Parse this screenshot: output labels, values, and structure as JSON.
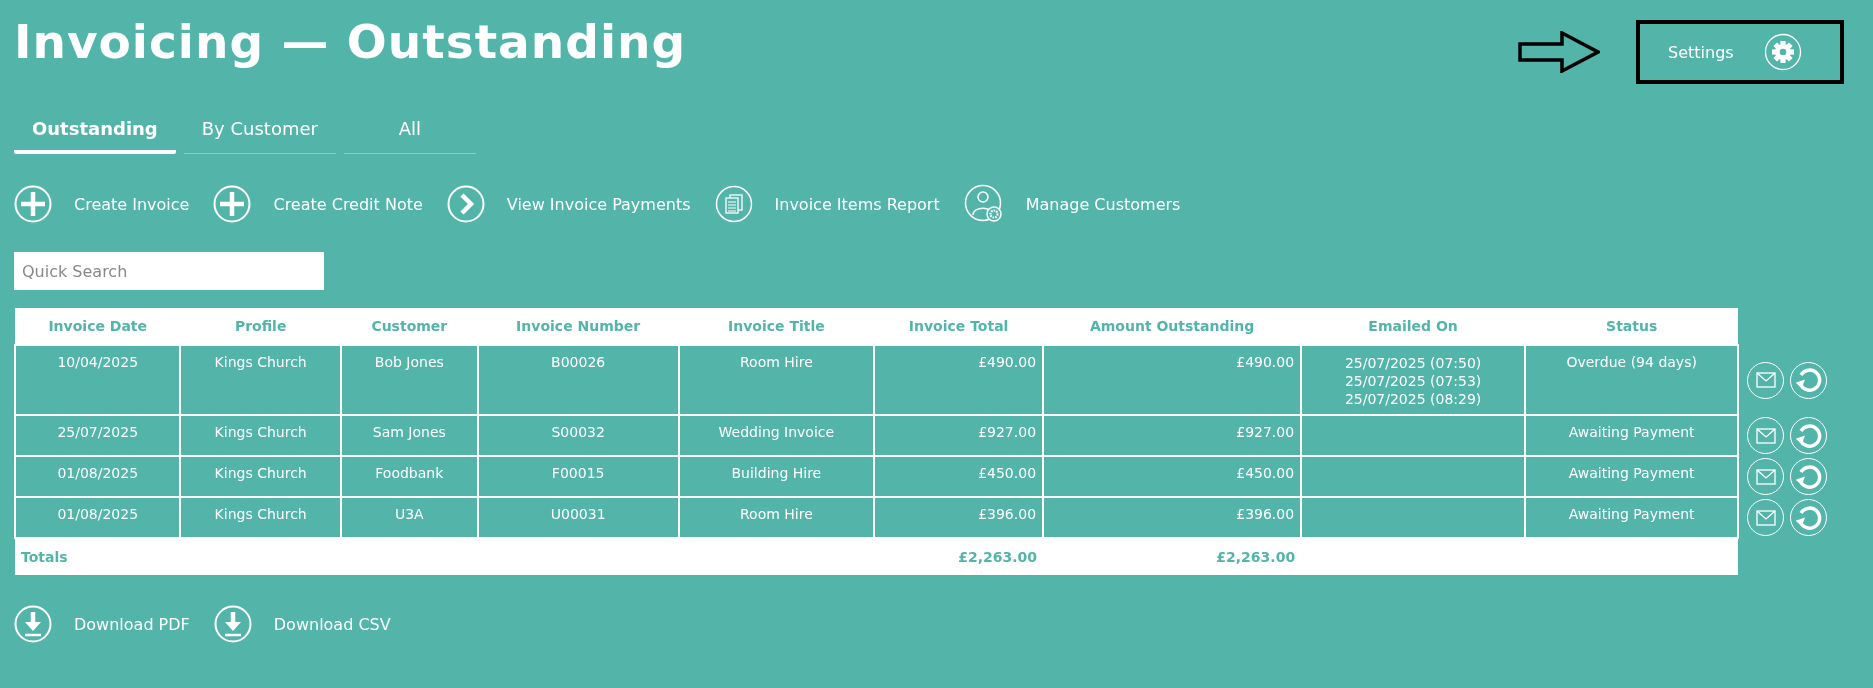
{
  "title": "Invoicing — Outstanding",
  "settings": {
    "label": "Settings"
  },
  "tabs": [
    {
      "label": "Outstanding",
      "selected": true
    },
    {
      "label": "By Customer",
      "selected": false
    },
    {
      "label": "All",
      "selected": false
    }
  ],
  "actions": [
    {
      "label": "Create Invoice",
      "kind": "plus"
    },
    {
      "label": "Create Credit Note",
      "kind": "plus"
    },
    {
      "label": "View Invoice Payments",
      "kind": "chevron"
    },
    {
      "label": "Invoice Items Report",
      "kind": "report"
    },
    {
      "label": "Manage Customers",
      "kind": "customers"
    }
  ],
  "search": {
    "placeholder": "Quick Search"
  },
  "table": {
    "columns": [
      "Invoice Date",
      "Profile",
      "Customer",
      "Invoice Number",
      "Invoice Title",
      "Invoice Total",
      "Amount Outstanding",
      "Emailed On",
      "Status"
    ],
    "rows": [
      {
        "date": "10/04/2025",
        "profile": "Kings Church",
        "customer": "Bob Jones",
        "number": "B00026",
        "title": "Room Hire",
        "total": "£490.00",
        "outstanding": "£490.00",
        "emailed_on": [
          "25/07/2025 (07:50)",
          "25/07/2025 (07:53)",
          "25/07/2025 (08:29)"
        ],
        "status": "Overdue (94 days)"
      },
      {
        "date": "25/07/2025",
        "profile": "Kings Church",
        "customer": "Sam Jones",
        "number": "S00032",
        "title": "Wedding Invoice",
        "total": "£927.00",
        "outstanding": "£927.00",
        "emailed_on": [],
        "status": "Awaiting Payment"
      },
      {
        "date": "01/08/2025",
        "profile": "Kings Church",
        "customer": "Foodbank",
        "number": "F00015",
        "title": "Building Hire",
        "total": "£450.00",
        "outstanding": "£450.00",
        "emailed_on": [],
        "status": "Awaiting Payment"
      },
      {
        "date": "01/08/2025",
        "profile": "Kings Church",
        "customer": "U3A",
        "number": "U00031",
        "title": "Room Hire",
        "total": "£396.00",
        "outstanding": "£396.00",
        "emailed_on": [],
        "status": "Awaiting Payment"
      }
    ],
    "totals": {
      "label": "Totals",
      "total": "£2,263.00",
      "outstanding": "£2,263.00"
    }
  },
  "downloads": [
    {
      "label": "Download PDF"
    },
    {
      "label": "Download CSV"
    }
  ]
}
